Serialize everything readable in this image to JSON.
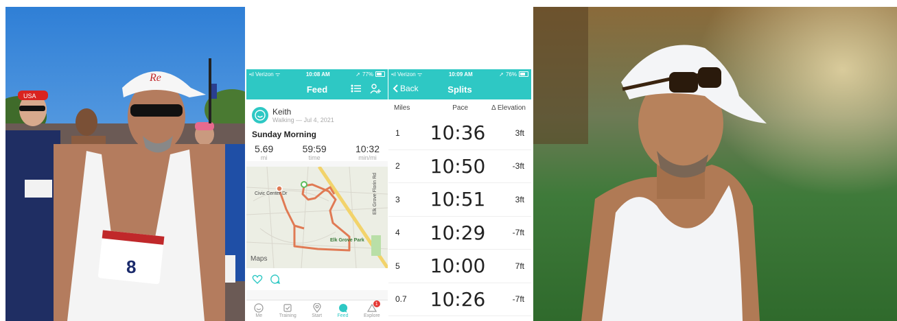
{
  "feed_screen": {
    "status": {
      "carrier": "Verizon",
      "time": "10:08 AM",
      "battery": "77%"
    },
    "nav": {
      "title": "Feed"
    },
    "activity": {
      "user_name": "Keith",
      "subtitle": "Walking — Jul 4, 2021",
      "title": "Sunday Morning",
      "stats": [
        {
          "value": "5.69",
          "unit": "mi"
        },
        {
          "value": "59:59",
          "unit": "time"
        },
        {
          "value": "10:32",
          "unit": "min/mi"
        }
      ],
      "map": {
        "attribution": "Maps",
        "labels": [
          "Civic Center Dr",
          "Elk Grove Park",
          "Elk Grove Florin Rd"
        ]
      }
    },
    "tabs": [
      {
        "label": "Me",
        "icon": "me-icon"
      },
      {
        "label": "Training",
        "icon": "training-icon"
      },
      {
        "label": "Start",
        "icon": "start-icon"
      },
      {
        "label": "Feed",
        "icon": "feed-icon"
      },
      {
        "label": "Explore",
        "icon": "explore-icon",
        "badge": "1"
      }
    ],
    "accent": "#2ec8c4",
    "route_color": "#e07a54"
  },
  "splits_screen": {
    "status": {
      "carrier": "Verizon",
      "time": "10:09 AM",
      "battery": "76%"
    },
    "nav": {
      "title": "Splits",
      "back_label": "Back"
    },
    "headers": {
      "miles": "Miles",
      "pace": "Pace",
      "elevation": "Δ Elevation"
    },
    "rows": [
      {
        "mile": "1",
        "pace": "10:36",
        "elev": "3ft"
      },
      {
        "mile": "2",
        "pace": "10:50",
        "elev": "-3ft"
      },
      {
        "mile": "3",
        "pace": "10:51",
        "elev": "3ft"
      },
      {
        "mile": "4",
        "pace": "10:29",
        "elev": "-7ft"
      },
      {
        "mile": "5",
        "pace": "10:00",
        "elev": "7ft"
      },
      {
        "mile": "0.7",
        "pace": "10:26",
        "elev": "-7ft"
      }
    ]
  },
  "photo_left": {
    "cap_text": "USA",
    "bib_number": "8"
  }
}
